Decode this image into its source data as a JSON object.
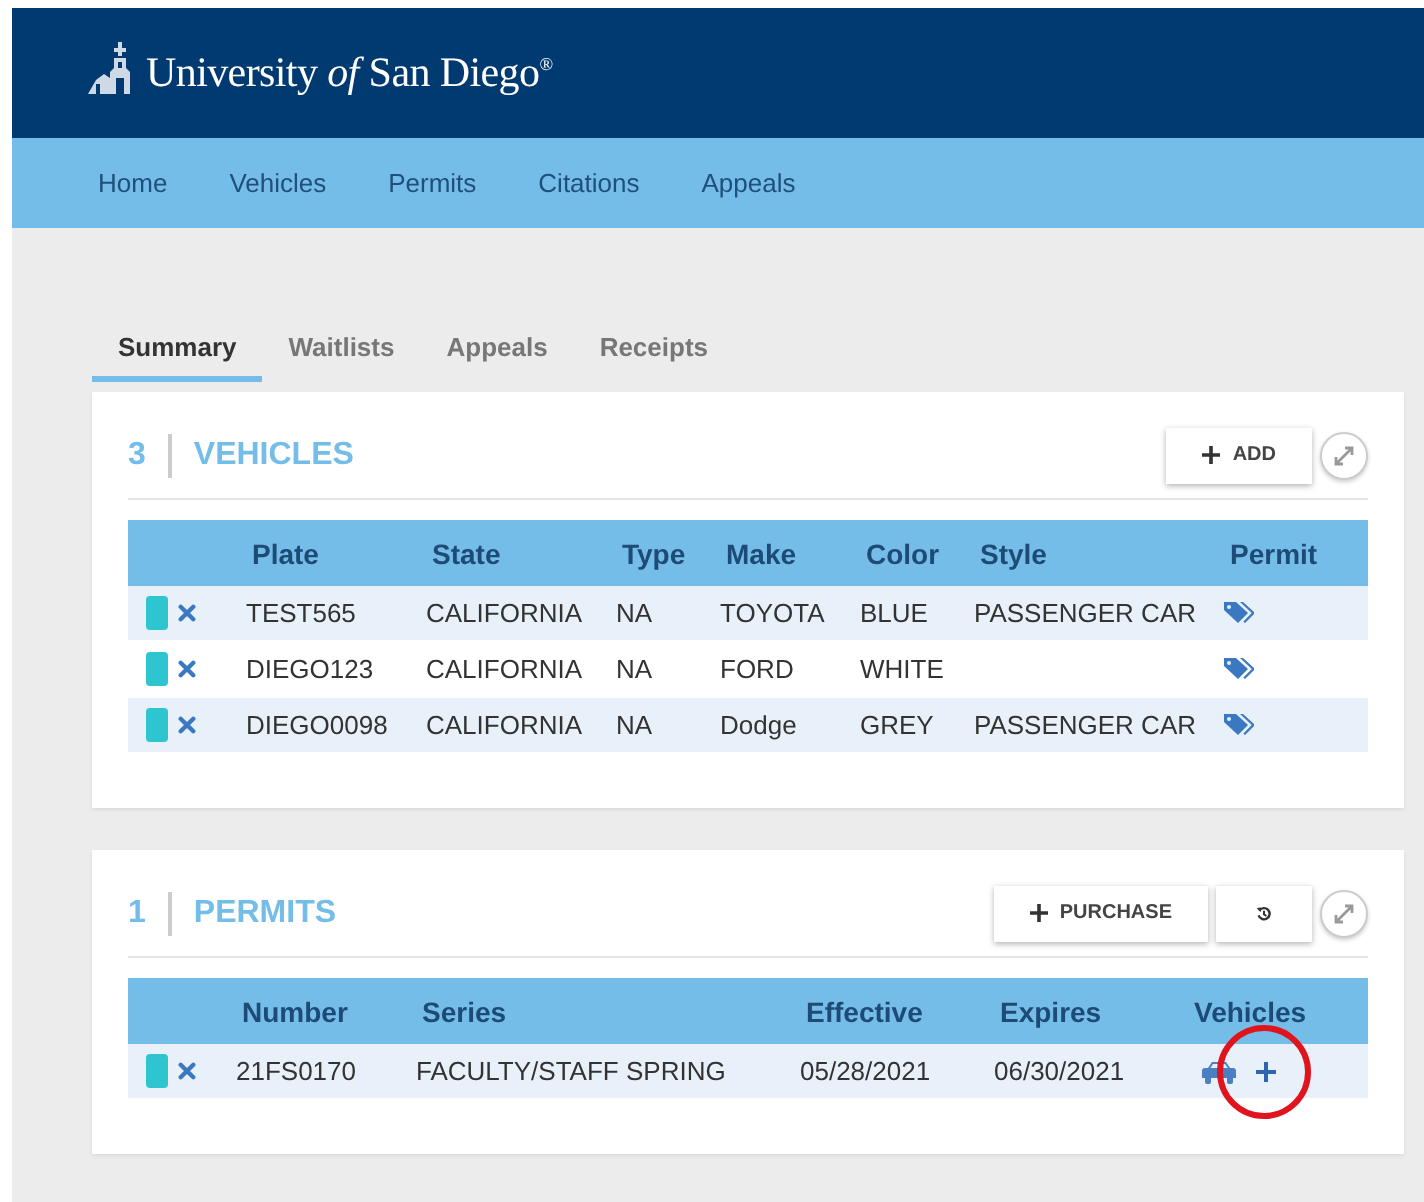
{
  "header": {
    "logo": "University *of* San Diego$^{®}$"
  },
  "nav": {
    "items": [
      {
        "label": "Home"
      },
      {
        "label": "Vehicles"
      },
      {
        "label": "Permits"
      },
      {
        "label": "Citations"
      },
      {
        "label": "Appeals"
      }
    ]
  },
  "tabs": [
    {
      "label": "Summary",
      "selected": true
    },
    {
      "label": "Waitlists",
      "selected": false
    },
    {
      "label": "Appeals",
      "selected": false
    },
    {
      "label": "Receipts",
      "selected": false
    }
  ],
  "cards": [
    {
      "count": "3",
      "title": "VEHICLES",
      "buttons": [
        {
          "kind": "add",
          "label": "ADD"
        }
      ],
      "columns": [
        {
          "label": "Plate",
          "kind": "text"
        },
        {
          "label": "State",
          "kind": "text"
        },
        {
          "label": "Type",
          "kind": "text"
        },
        {
          "label": "Make",
          "kind": "text"
        },
        {
          "label": "Color",
          "kind": "text"
        },
        {
          "label": "Style",
          "kind": "text"
        },
        {
          "label": "Permit",
          "kind": "tag"
        }
      ],
      "rows": [
        {
          "color": "#2ec4d0",
          "cells": [
            "TEST565",
            "CALIFORNIA",
            "NA",
            "TOYOTA",
            "BLUE",
            "PASSENGER CAR"
          ]
        },
        {
          "color": "#2ec4d0",
          "cells": [
            "DIEGO123",
            "CALIFORNIA",
            "NA",
            "FORD",
            "WHITE",
            null
          ]
        },
        {
          "color": "#2ec4d0",
          "cells": [
            "DIEGO0098",
            "CALIFORNIA",
            "NA",
            "Dodge",
            "GREY",
            "PASSENGER CAR"
          ]
        }
      ]
    },
    {
      "count": "1",
      "title": "PERMITS",
      "buttons": [
        {
          "kind": "add",
          "label": "PURCHASE"
        },
        {
          "kind": "history"
        }
      ],
      "columns": [
        {
          "label": "Number",
          "kind": "text"
        },
        {
          "label": "Series",
          "kind": "text"
        },
        {
          "label": "Effective",
          "kind": "text"
        },
        {
          "label": "Expires",
          "kind": "text"
        },
        {
          "label": "Vehicles",
          "kind": "vehicles"
        }
      ],
      "rows": [
        {
          "color": "#2ec4d0",
          "highlighted": true,
          "cells": [
            "21FS0170",
            "FACULTY/STAFF SPRING",
            "05/28/2021",
            "06/30/2021"
          ]
        }
      ]
    }
  ]
}
